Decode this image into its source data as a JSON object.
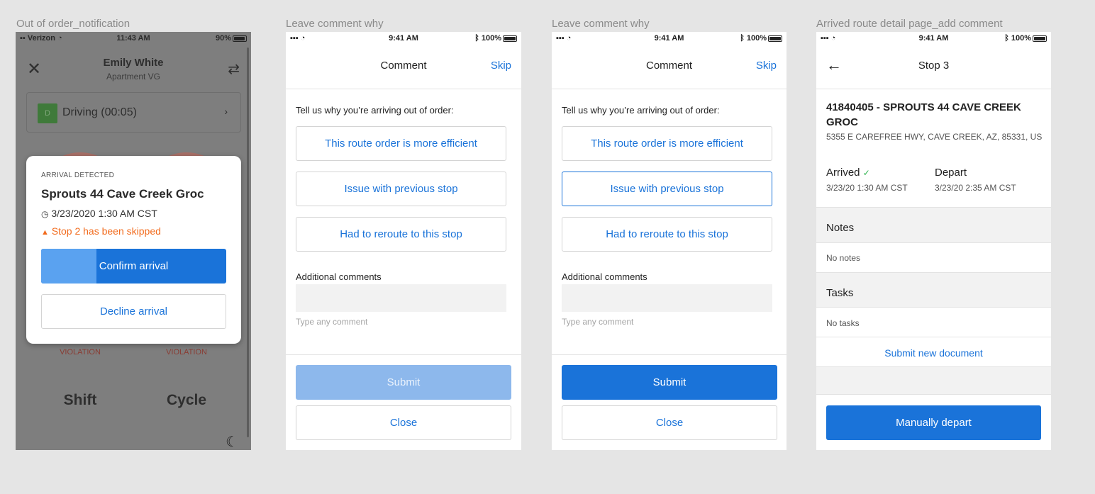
{
  "frames": [
    {
      "label": "Out of order_notification",
      "status": {
        "carrier": "Verizon",
        "time": "11:43 AM",
        "battery": "90%"
      },
      "header": {
        "name": "Emily White",
        "subtitle": "Apartment VG"
      },
      "duty": {
        "badge": "D",
        "label": "Driving (00:05)"
      },
      "gauges": [
        {
          "status": "VIOLATION",
          "label": "Shift"
        },
        {
          "status": "VIOLATION",
          "label": "Cycle"
        }
      ],
      "modal": {
        "eyebrow": "ARRIVAL DETECTED",
        "title": "Sprouts 44 Cave Creek Groc",
        "time": "3/23/2020 1:30 AM CST",
        "warning": "Stop 2 has been skipped",
        "confirm_label": "Confirm arrival",
        "confirm_progress": 0.3,
        "decline_label": "Decline arrival"
      }
    },
    {
      "label": "Leave comment why",
      "status": {
        "time": "9:41 AM",
        "battery": "100%"
      },
      "header": {
        "title": "Comment",
        "skip": "Skip"
      },
      "prompt": "Tell us why you’re arriving out of order:",
      "options": [
        "This route order is more efficient",
        "Issue with previous stop",
        "Had to reroute to this stop"
      ],
      "selected": null,
      "comments_label": "Additional comments",
      "comments_placeholder": "Type any comment",
      "submit": "Submit",
      "submit_enabled": false,
      "close": "Close"
    },
    {
      "label": "Leave comment why",
      "status": {
        "time": "9:41 AM",
        "battery": "100%"
      },
      "header": {
        "title": "Comment",
        "skip": "Skip"
      },
      "prompt": "Tell us why you’re arriving out of order:",
      "options": [
        "This route order is more efficient",
        "Issue with previous stop",
        "Had to reroute to this stop"
      ],
      "selected": "Issue with previous stop",
      "comments_label": "Additional comments",
      "comments_placeholder": "Type any comment",
      "submit": "Submit",
      "submit_enabled": true,
      "close": "Close"
    },
    {
      "label": "Arrived route detail page_add comment",
      "status": {
        "time": "9:41 AM",
        "battery": "100%"
      },
      "header": {
        "title": "Stop 3"
      },
      "stop_title": "41840405 - SPROUTS 44 CAVE CREEK GROC",
      "address": "5355 E CAREFREE HWY, CAVE CREEK, AZ, 85331, US",
      "arrived": {
        "label": "Arrived",
        "time": "3/23/20 1:30 AM CST"
      },
      "depart": {
        "label": "Depart",
        "time": "3/23/20 2:35 AM CST"
      },
      "notes": {
        "title": "Notes",
        "empty": "No notes"
      },
      "tasks": {
        "title": "Tasks",
        "empty": "No tasks"
      },
      "submit_doc": "Submit new document",
      "depart_button": "Manually depart"
    }
  ],
  "colors": {
    "primary": "#1a73d9",
    "primary_disabled": "#8db8ec",
    "warning": "#f26b1d",
    "success": "#2bb24c"
  }
}
